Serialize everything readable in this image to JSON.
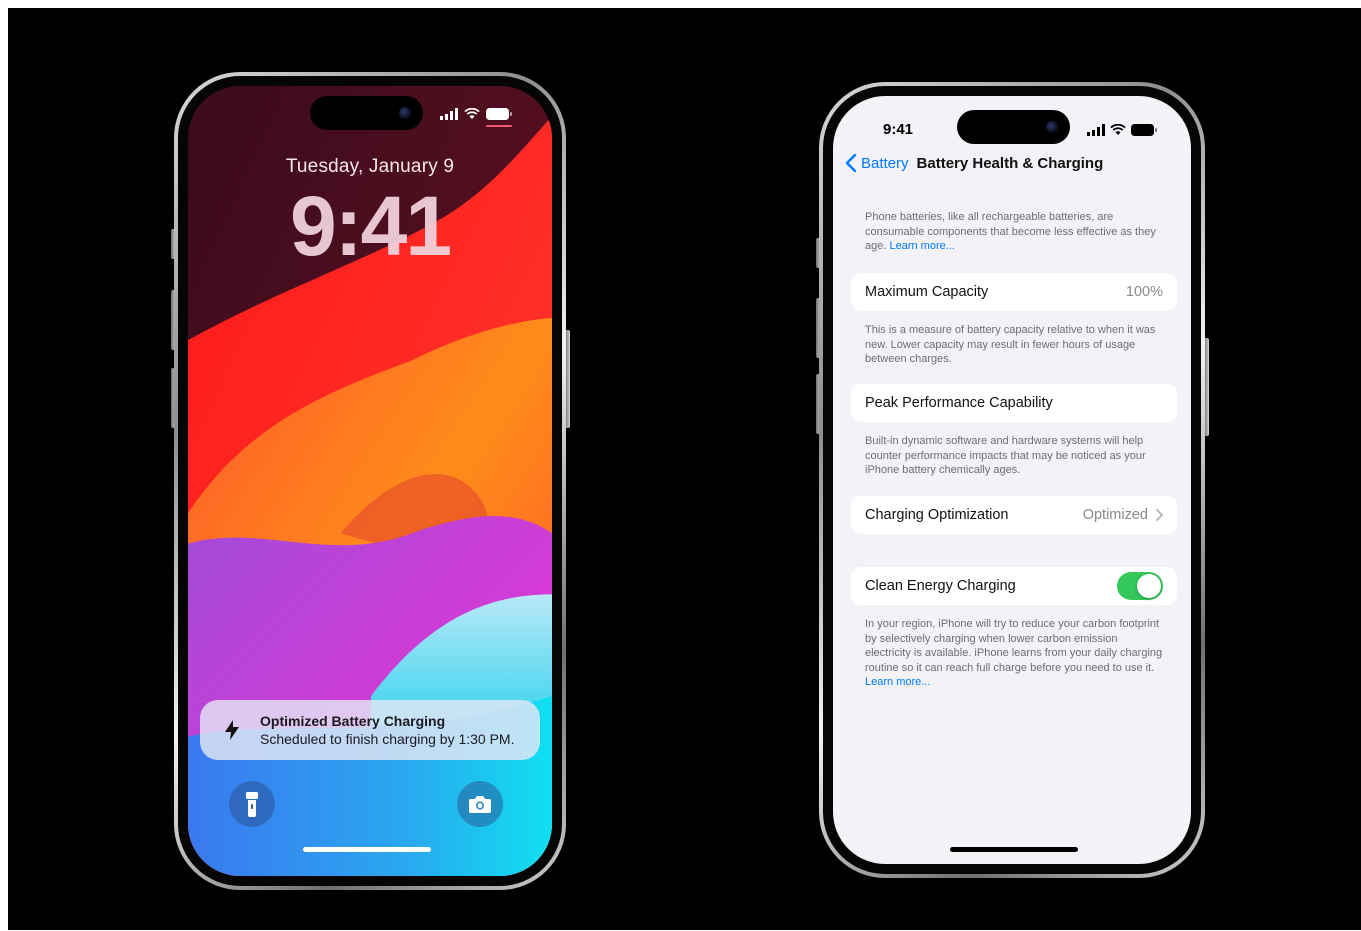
{
  "lock_screen": {
    "date": "Tuesday, January 9",
    "time": "9:41",
    "notification": {
      "title": "Optimized Battery Charging",
      "body": "Scheduled to finish charging by 1:30 PM."
    },
    "icons": [
      "bolt-icon",
      "flashlight-icon",
      "camera-icon",
      "signal-icon",
      "wifi-icon",
      "battery-icon"
    ]
  },
  "settings_screen": {
    "status_time": "9:41",
    "nav": {
      "back_label": "Battery",
      "title": "Battery Health & Charging"
    },
    "intro": {
      "text": "Phone batteries, like all rechargeable batteries, are consumable components that become less effective as they age.",
      "link": "Learn more..."
    },
    "rows": {
      "max_capacity": {
        "label": "Maximum Capacity",
        "value": "100%",
        "footer": "This is a measure of battery capacity relative to when it was new. Lower capacity may result in fewer hours of usage between charges."
      },
      "peak_performance": {
        "label": "Peak Performance Capability",
        "footer": "Built-in dynamic software and hardware systems will help counter performance impacts that may be noticed as your iPhone battery chemically ages."
      },
      "charging_optimization": {
        "label": "Charging Optimization",
        "value": "Optimized"
      },
      "clean_energy": {
        "label": "Clean Energy Charging",
        "enabled": true,
        "footer": "In your region, iPhone will try to reduce your carbon footprint by selectively charging when lower carbon emission electricity is available. iPhone learns from your daily charging routine so it can reach full charge before you need to use it.",
        "footer_link": "Learn more..."
      }
    }
  },
  "colors": {
    "ios_blue": "#007aff",
    "toggle_green": "#34c759",
    "settings_bg": "#f2f2f7"
  }
}
